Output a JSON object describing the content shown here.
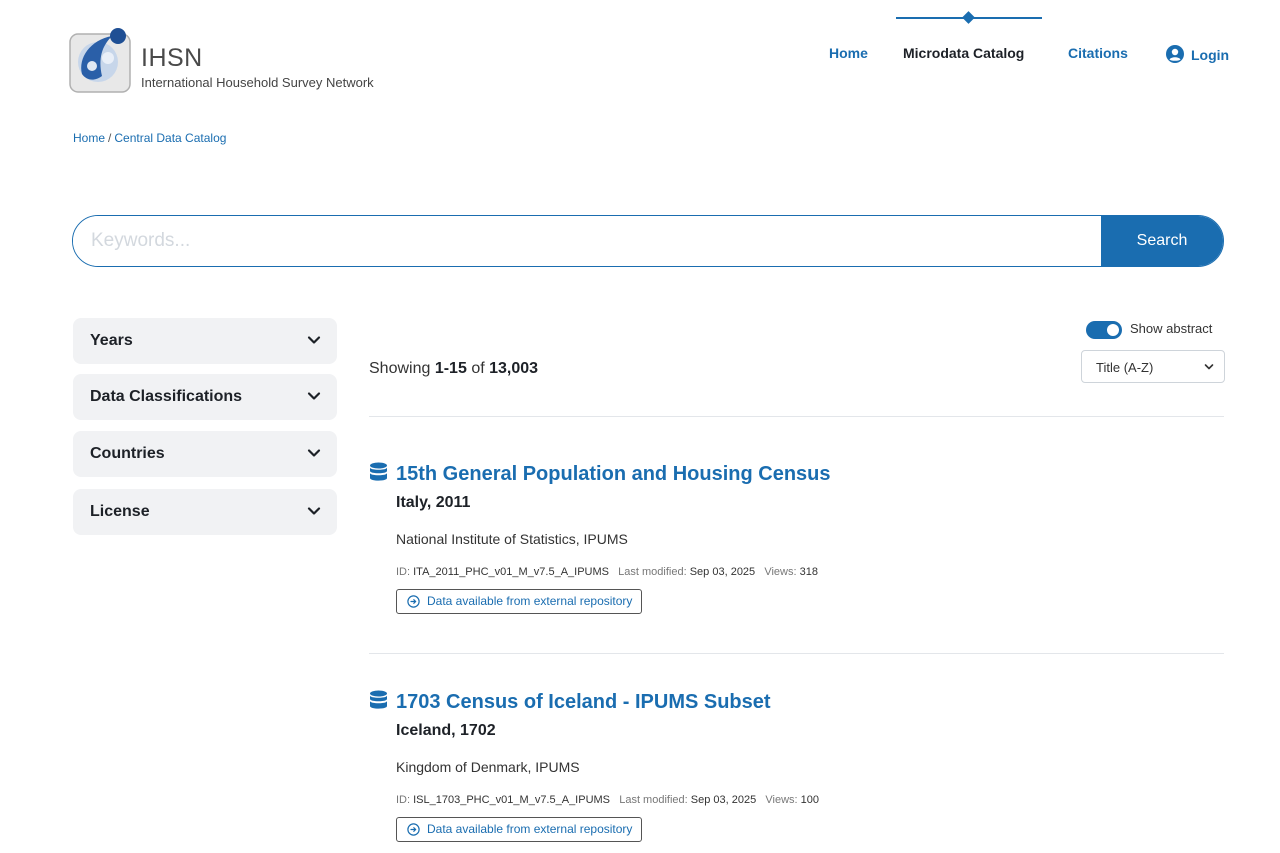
{
  "brand": {
    "title": "IHSN",
    "subtitle": "International Household Survey Network"
  },
  "nav": {
    "home": "Home",
    "catalog": "Microdata Catalog",
    "citations": "Citations",
    "login": "Login"
  },
  "breadcrumb": {
    "home": "Home",
    "separator": "/",
    "current": "Central Data Catalog"
  },
  "search": {
    "placeholder": "Keywords...",
    "button": "Search"
  },
  "filters": [
    {
      "label": "Years"
    },
    {
      "label": "Data Classifications"
    },
    {
      "label": "Countries"
    },
    {
      "label": "License"
    }
  ],
  "results_header": {
    "showing_prefix": "Showing",
    "range": "1-15",
    "of": "of",
    "total": "13,003",
    "toggle_label": "Show abstract",
    "toggle_on": true,
    "sort_value": "Title (A-Z)"
  },
  "results": [
    {
      "title": "15th General Population and Housing Census",
      "country_year": "Italy, 2011",
      "producers": "National Institute of Statistics, IPUMS",
      "id_label": "ID:",
      "id": "ITA_2011_PHC_v01_M_v7.5_A_IPUMS",
      "modified_label": "Last modified:",
      "modified": "Sep 03, 2025",
      "views_label": "Views:",
      "views": "318",
      "badge": "Data available from external repository"
    },
    {
      "title": "1703 Census of Iceland - IPUMS Subset",
      "country_year": "Iceland, 1702",
      "producers": "Kingdom of Denmark, IPUMS",
      "id_label": "ID:",
      "id": "ISL_1703_PHC_v01_M_v7.5_A_IPUMS",
      "modified_label": "Last modified:",
      "modified": "Sep 03, 2025",
      "views_label": "Views:",
      "views": "100",
      "badge": "Data available from external repository"
    }
  ],
  "colors": {
    "primary": "#1a6db0",
    "dark_text": "#1d2127",
    "filter_bg": "#f1f2f4"
  },
  "icons": {
    "logo": "ihsn-logo-icon",
    "login": "user-circle-icon",
    "filter": "chevron-down-icon",
    "result": "database-icon",
    "badge": "arrow-circle-right-icon"
  }
}
